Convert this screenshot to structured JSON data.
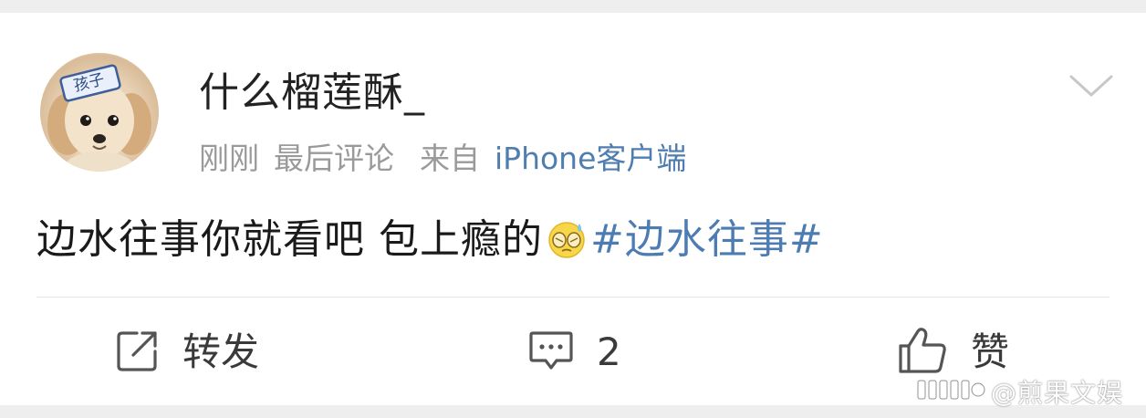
{
  "post": {
    "author": {
      "name": "什么榴莲酥_",
      "avatar_badge_text": "孩子"
    },
    "meta": {
      "time": "刚刚",
      "last_comment": "最后评论",
      "from_label": "来自",
      "source": "iPhone客户端"
    },
    "content": {
      "text": "边水往事你就看吧 包上瘾的",
      "emoji_icon": "sweat-cover-face-emoji",
      "hashtag": "#边水往事#"
    },
    "actions": {
      "repost_label": "转发",
      "comment_count": "2",
      "like_label": "赞"
    }
  },
  "watermark": {
    "text": "@煎果文娱"
  },
  "colors": {
    "link": "#507daf",
    "hashtag": "#4d7cb3",
    "meta": "#9a9a9a",
    "text": "#1a1a1a",
    "background": "#eeeeee"
  }
}
